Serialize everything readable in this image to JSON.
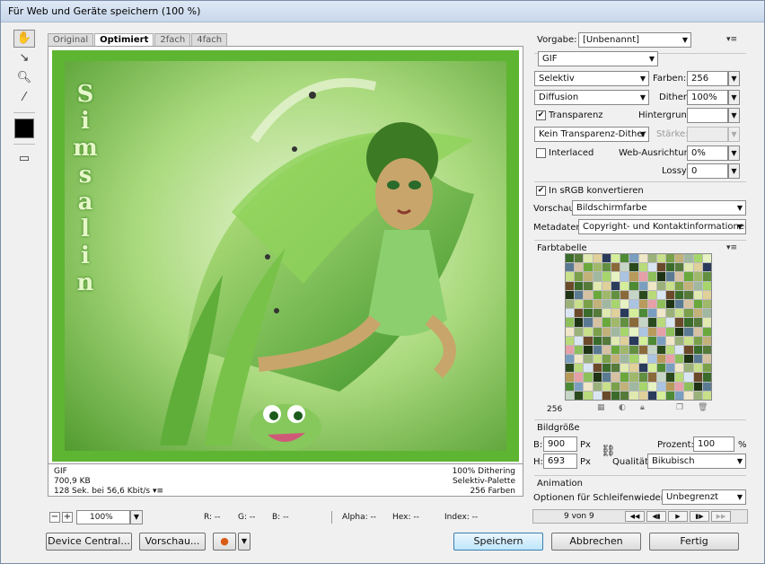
{
  "window": {
    "title": "Für Web und Geräte speichern (100 %)"
  },
  "tabs": [
    "Original",
    "Optimiert",
    "2fach",
    "4fach"
  ],
  "image": {
    "watermark": "Simsalin"
  },
  "info_left": {
    "format": "GIF",
    "size": "700,9 KB",
    "time": "128 Sek. bei 56,6 Kbit/s"
  },
  "info_right": {
    "dither": "100% Dithering",
    "palette": "Selektiv-Palette",
    "colors": "256 Farben"
  },
  "statusbar": {
    "zoom": "100%",
    "r": "R: --",
    "g": "G: --",
    "b": "B: --",
    "alpha": "Alpha: --",
    "hex": "Hex: --",
    "index": "Index: --"
  },
  "buttons": {
    "device_central": "Device Central...",
    "preview": "Vorschau...",
    "save": "Speichern",
    "cancel": "Abbrechen",
    "done": "Fertig"
  },
  "settings": {
    "preset_label": "Vorgabe:",
    "preset_value": "[Unbenannt]",
    "format": "GIF",
    "reduction": "Selektiv",
    "colors_label": "Farben:",
    "colors_value": "256",
    "dither_algo": "Diffusion",
    "dither_label": "Dither:",
    "dither_value": "100%",
    "transparency": "Transparenz",
    "matte_label": "Hintergrund:",
    "transparency_dither": "Kein Transparenz-Dither",
    "amount_label": "Stärke:",
    "interlaced": "Interlaced",
    "web_snap_label": "Web-Ausrichtung:",
    "web_snap_value": "0%",
    "lossy_label": "Lossy:",
    "lossy_value": "0",
    "srgb": "In sRGB konvertieren",
    "preview_label": "Vorschau:",
    "preview_value": "Bildschirmfarbe",
    "metadata_label": "Metadaten:",
    "metadata_value": "Copyright- und Kontaktinformationen"
  },
  "color_table": {
    "title": "Farbtabelle",
    "count": "256"
  },
  "image_size": {
    "title": "Bildgröße",
    "w_label": "B:",
    "w_value": "900",
    "h_label": "H:",
    "h_value": "693",
    "unit": "Px",
    "percent_label": "Prozent:",
    "percent_value": "100",
    "percent_unit": "%",
    "quality_label": "Qualität:",
    "quality_value": "Bikubisch"
  },
  "animation": {
    "title": "Animation",
    "loop_label": "Optionen für Schleifenwiedergabe:",
    "loop_value": "Unbegrenzt",
    "frame": "9 von 9"
  }
}
